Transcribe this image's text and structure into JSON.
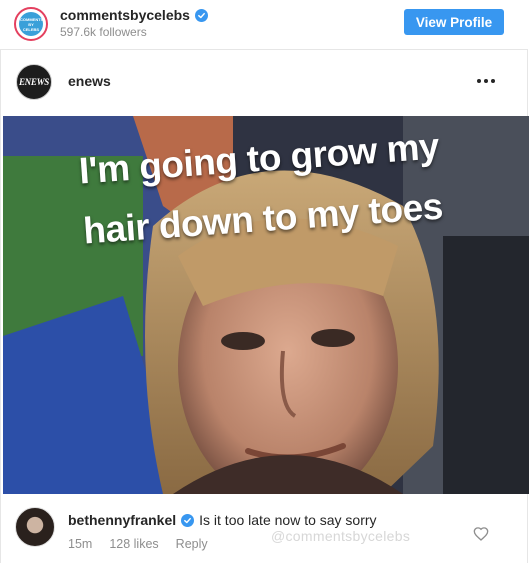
{
  "embed": {
    "account_name": "commentsbycelebs",
    "followers": "597.6k followers",
    "view_profile_label": "View Profile",
    "avatar_logo_text": "COMMENTS BY CELEBS"
  },
  "post": {
    "username": "enews",
    "avatar_text": "ENEWS",
    "caption_line1": "I'm going to grow my",
    "caption_line2": "hair down to my toes"
  },
  "comment": {
    "username": "bethennyfrankel",
    "text": "Is it too late now to say sorry",
    "time": "15m",
    "likes": "128 likes",
    "reply_label": "Reply",
    "watermark": "@commentsbycelebs"
  },
  "colors": {
    "accent_blue": "#3897f0",
    "muted_text": "#8e8e8e",
    "border": "#e6e6e6"
  }
}
